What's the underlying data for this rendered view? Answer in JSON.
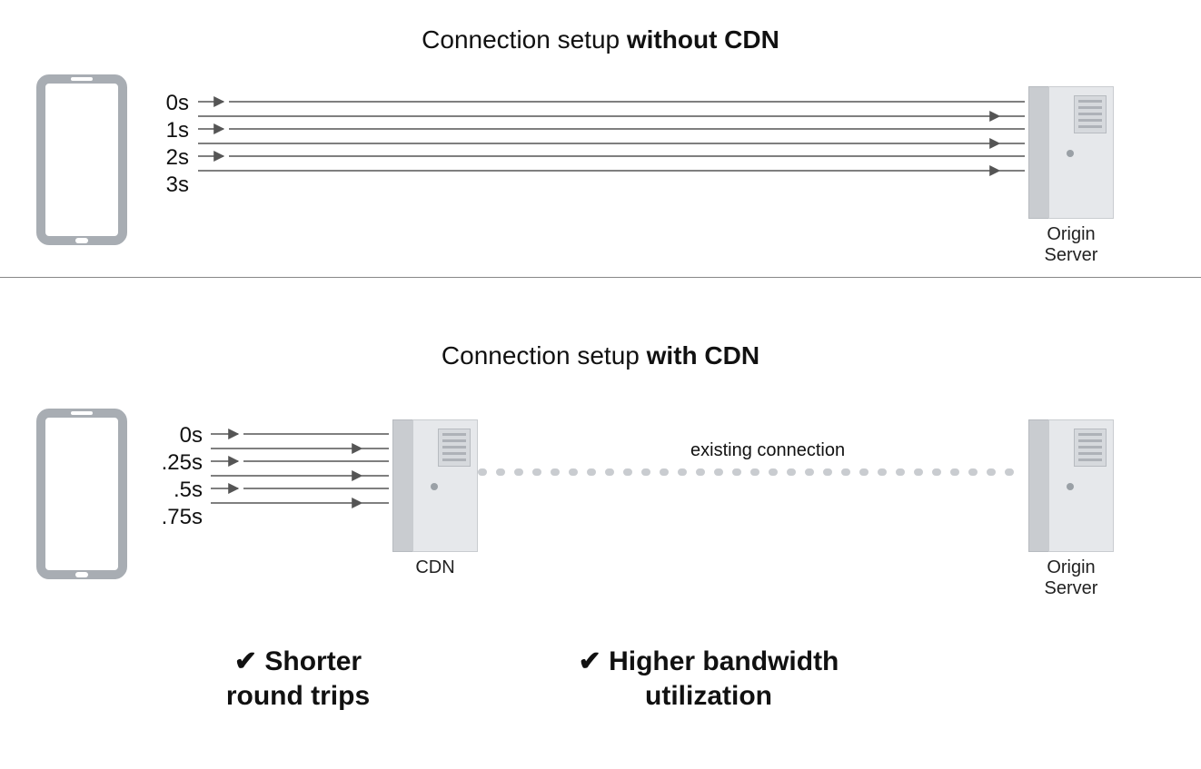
{
  "top": {
    "title_prefix": "Connection setup ",
    "title_bold": "without CDN",
    "times": [
      "0s",
      "1s",
      "2s",
      "3s"
    ],
    "origin_label_l1": "Origin",
    "origin_label_l2": "Server"
  },
  "bottom": {
    "title_prefix": "Connection setup ",
    "title_bold": "with CDN",
    "times": [
      "0s",
      ".25s",
      ".5s",
      ".75s"
    ],
    "cdn_label": "CDN",
    "origin_label_l1": "Origin",
    "origin_label_l2": "Server",
    "existing_label": "existing connection"
  },
  "benefits": {
    "b1_l1": "✔ Shorter",
    "b1_l2": "round trips",
    "b2_l1": "✔ Higher bandwidth",
    "b2_l2": "utilization"
  }
}
